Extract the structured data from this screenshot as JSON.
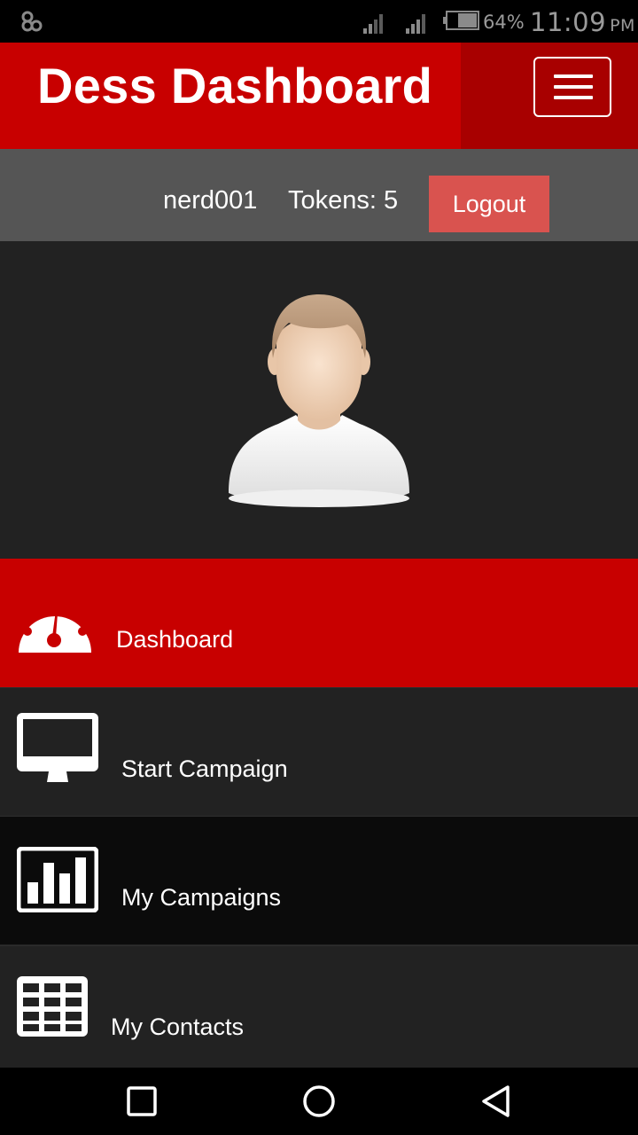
{
  "status_bar": {
    "battery_percent": "64%",
    "time": "11:09",
    "ampm": "PM"
  },
  "header": {
    "title": "Dess Dashboard",
    "menu_icon": "hamburger-menu-icon"
  },
  "user": {
    "username": "nerd001",
    "tokens_label": "Tokens: 5",
    "logout_label": "Logout"
  },
  "colors": {
    "brand_red": "#c80000",
    "active_item": "#c80000",
    "logout_bg": "#d9534f",
    "user_bar": "#555555",
    "background": "#222222"
  },
  "nav": {
    "items": [
      {
        "label": "Dashboard",
        "icon": "dashboard-gauge-icon",
        "active": true
      },
      {
        "label": "Start Campaign",
        "icon": "monitor-icon",
        "active": false
      },
      {
        "label": "My Campaigns",
        "icon": "bar-chart-icon",
        "active": false
      },
      {
        "label": "My Contacts",
        "icon": "table-grid-icon",
        "active": false
      }
    ]
  },
  "system_nav": {
    "recents_icon": "recents-square-icon",
    "home_icon": "home-circle-icon",
    "back_icon": "back-triangle-icon"
  }
}
